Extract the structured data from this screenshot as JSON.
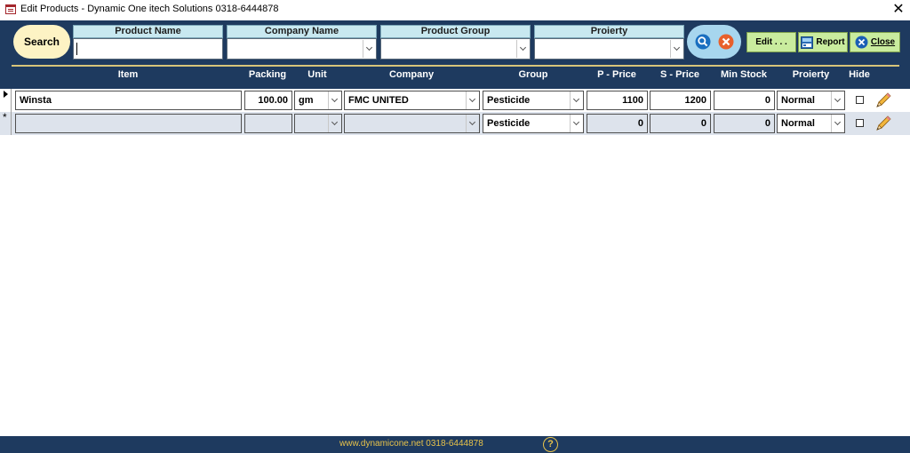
{
  "window": {
    "title": "Edit Products - Dynamic One itech Solutions 0318-6444878",
    "close_glyph": "✕"
  },
  "filters": {
    "search_label": "Search",
    "product_name": {
      "label": "Product Name",
      "value": ""
    },
    "company_name": {
      "label": "Company Name",
      "value": ""
    },
    "product_group": {
      "label": "Product Group",
      "value": ""
    },
    "priority": {
      "label": "Proierty",
      "value": ""
    }
  },
  "buttons": {
    "edit": "Edit . . .",
    "report": "Report",
    "close": "Close"
  },
  "columns": [
    "Item",
    "Packing",
    "Unit",
    "Company",
    "Group",
    "P - Price",
    "S - Price",
    "Min Stock",
    "Proierty",
    "Hide"
  ],
  "rows": [
    {
      "item": "Winsta",
      "packing": "100.00",
      "unit": "gm",
      "company": "FMC UNITED",
      "group": "Pesticide",
      "p_price": "1100",
      "s_price": "1200",
      "min_stock": "0",
      "priority": "Normal",
      "hide": false
    },
    {
      "item": "",
      "packing": "",
      "unit": "",
      "company": "",
      "group": "Pesticide",
      "p_price": "0",
      "s_price": "0",
      "min_stock": "0",
      "priority": "Normal",
      "hide": false
    }
  ],
  "footer": {
    "text": "www.dynamicone.net 0318-6444878",
    "help_glyph": "?"
  },
  "colors": {
    "header_bg": "#1e3a5f",
    "accent_green": "#c9ec9e",
    "search_pill": "#fdf3c4",
    "footer_text": "#e8c34a"
  }
}
